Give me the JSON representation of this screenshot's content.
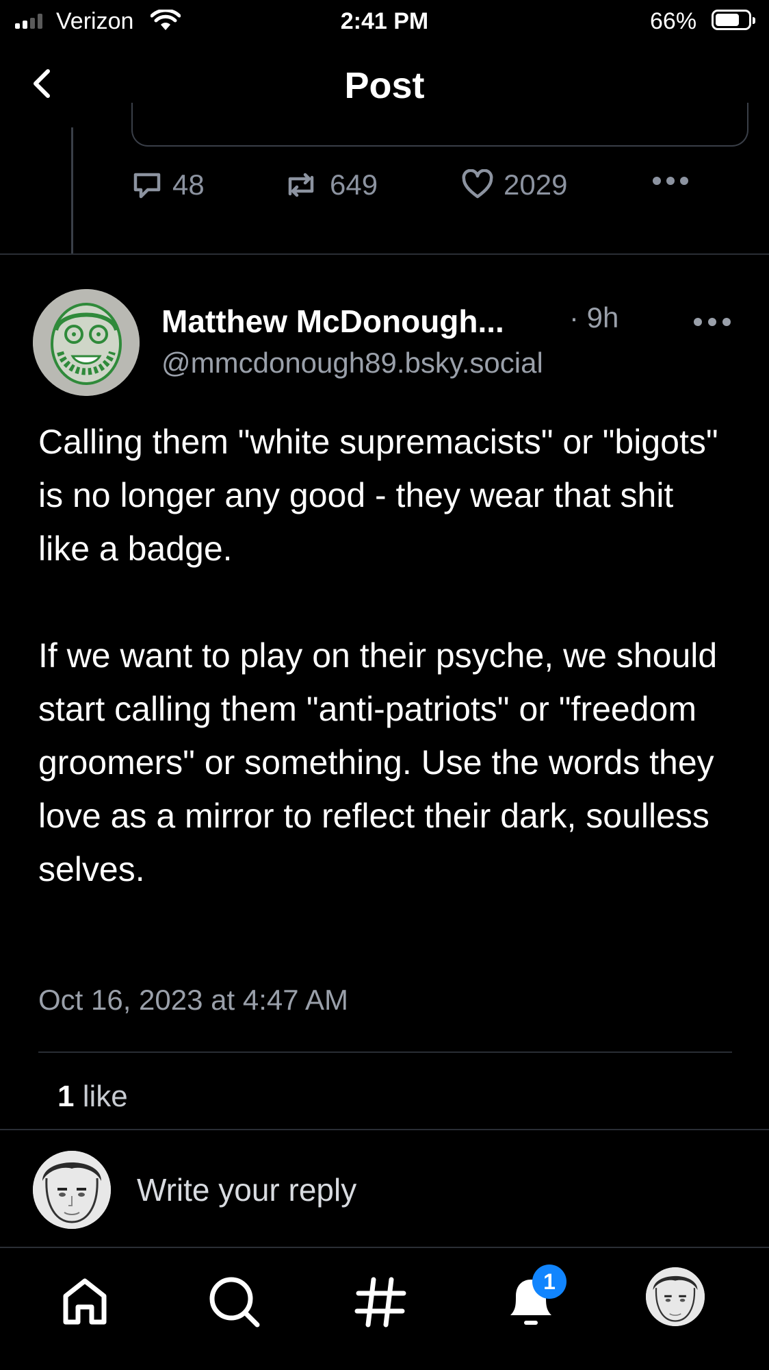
{
  "status_bar": {
    "carrier": "Verizon",
    "time": "2:41 PM",
    "battery_percent": "66%",
    "battery_level": 0.66
  },
  "nav": {
    "title": "Post"
  },
  "previous_post": {
    "replies": "48",
    "reposts": "649",
    "likes": "2029"
  },
  "post": {
    "author_name": "Matthew McDonough...",
    "time_ago": "· 9h",
    "handle": "@mmcdonough89.bsky.social",
    "text": "Calling them \"white supremacists\" or \"bigots\" is no longer any good - they wear that shit like a badge.\n\nIf we want to play on their psyche, we should start calling them \"anti-patriots\" or \"freedom groomers\" or something. Use the words they love as a mirror to reflect their dark, soulless selves.",
    "date": "Oct 16, 2023 at 4:47 AM",
    "like_count": "1",
    "like_label": "like"
  },
  "reply": {
    "placeholder": "Write your reply"
  },
  "tab_bar": {
    "notification_badge": "1",
    "icons": [
      "home-icon",
      "search-icon",
      "hashtag-icon",
      "notifications-icon",
      "profile-avatar"
    ]
  },
  "colors": {
    "background": "#000000",
    "muted_text": "#9aa0aa",
    "divider": "#2a2e35",
    "badge": "#1185fe"
  }
}
